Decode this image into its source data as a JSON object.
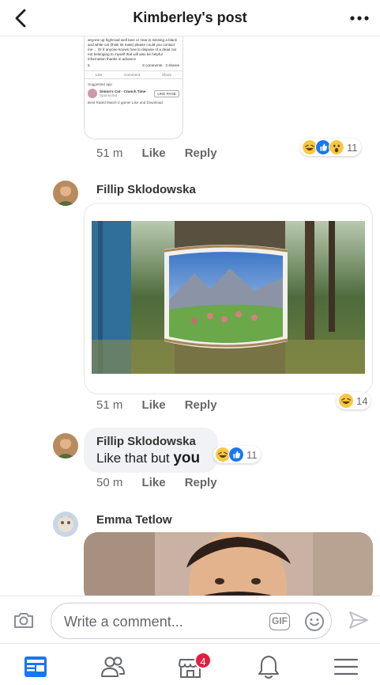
{
  "header": {
    "title": "Kimberley's post"
  },
  "shared_post": {
    "text": "anyone up highroad well lane or near is missing a black and white cat (think its male) please could you contact me ... Or if anyone knows how to dispose of a dead cat not belonging to myself that will also be helpful information thanks in advance",
    "reaction_count": "5",
    "comments_shares": "8 comments · 3 shares",
    "like": "Like",
    "comment": "Comment",
    "share": "Share",
    "suggested": "Suggested app",
    "app_name": "Simon's Cat - Crunch Time",
    "app_sub": "Sponsored",
    "app_like": "LIKE PAGE",
    "app_desc": "Best Rated Match-3 game! Like and Download"
  },
  "comments": [
    {
      "time": "51 m",
      "like": "Like",
      "reply": "Reply",
      "reaction_count": "11"
    },
    {
      "author": "Fillip Sklodowska",
      "time": "51 m",
      "like": "Like",
      "reply": "Reply",
      "reaction_count": "14"
    },
    {
      "author": "Fillip Sklodowska",
      "text": "Like that but",
      "text_bold": "you",
      "time": "50 m",
      "like": "Like",
      "reply": "Reply",
      "reaction_count": "11"
    },
    {
      "author": "Emma Tetlow"
    }
  ],
  "composer": {
    "placeholder": "Write a comment...",
    "gif_label": "GIF"
  },
  "nav": {
    "marketplace_badge": "4"
  },
  "icons": {
    "back": "chevron-left-icon",
    "more": "more-horizontal-icon",
    "camera": "camera-icon",
    "emoji": "smiley-icon",
    "send": "send-icon",
    "tabs": [
      "news-feed-icon",
      "friends-icon",
      "marketplace-icon",
      "notifications-icon",
      "menu-icon"
    ]
  },
  "colors": {
    "accent": "#1877f2",
    "badge": "#e41e3f",
    "meta_text": "#65676b"
  }
}
